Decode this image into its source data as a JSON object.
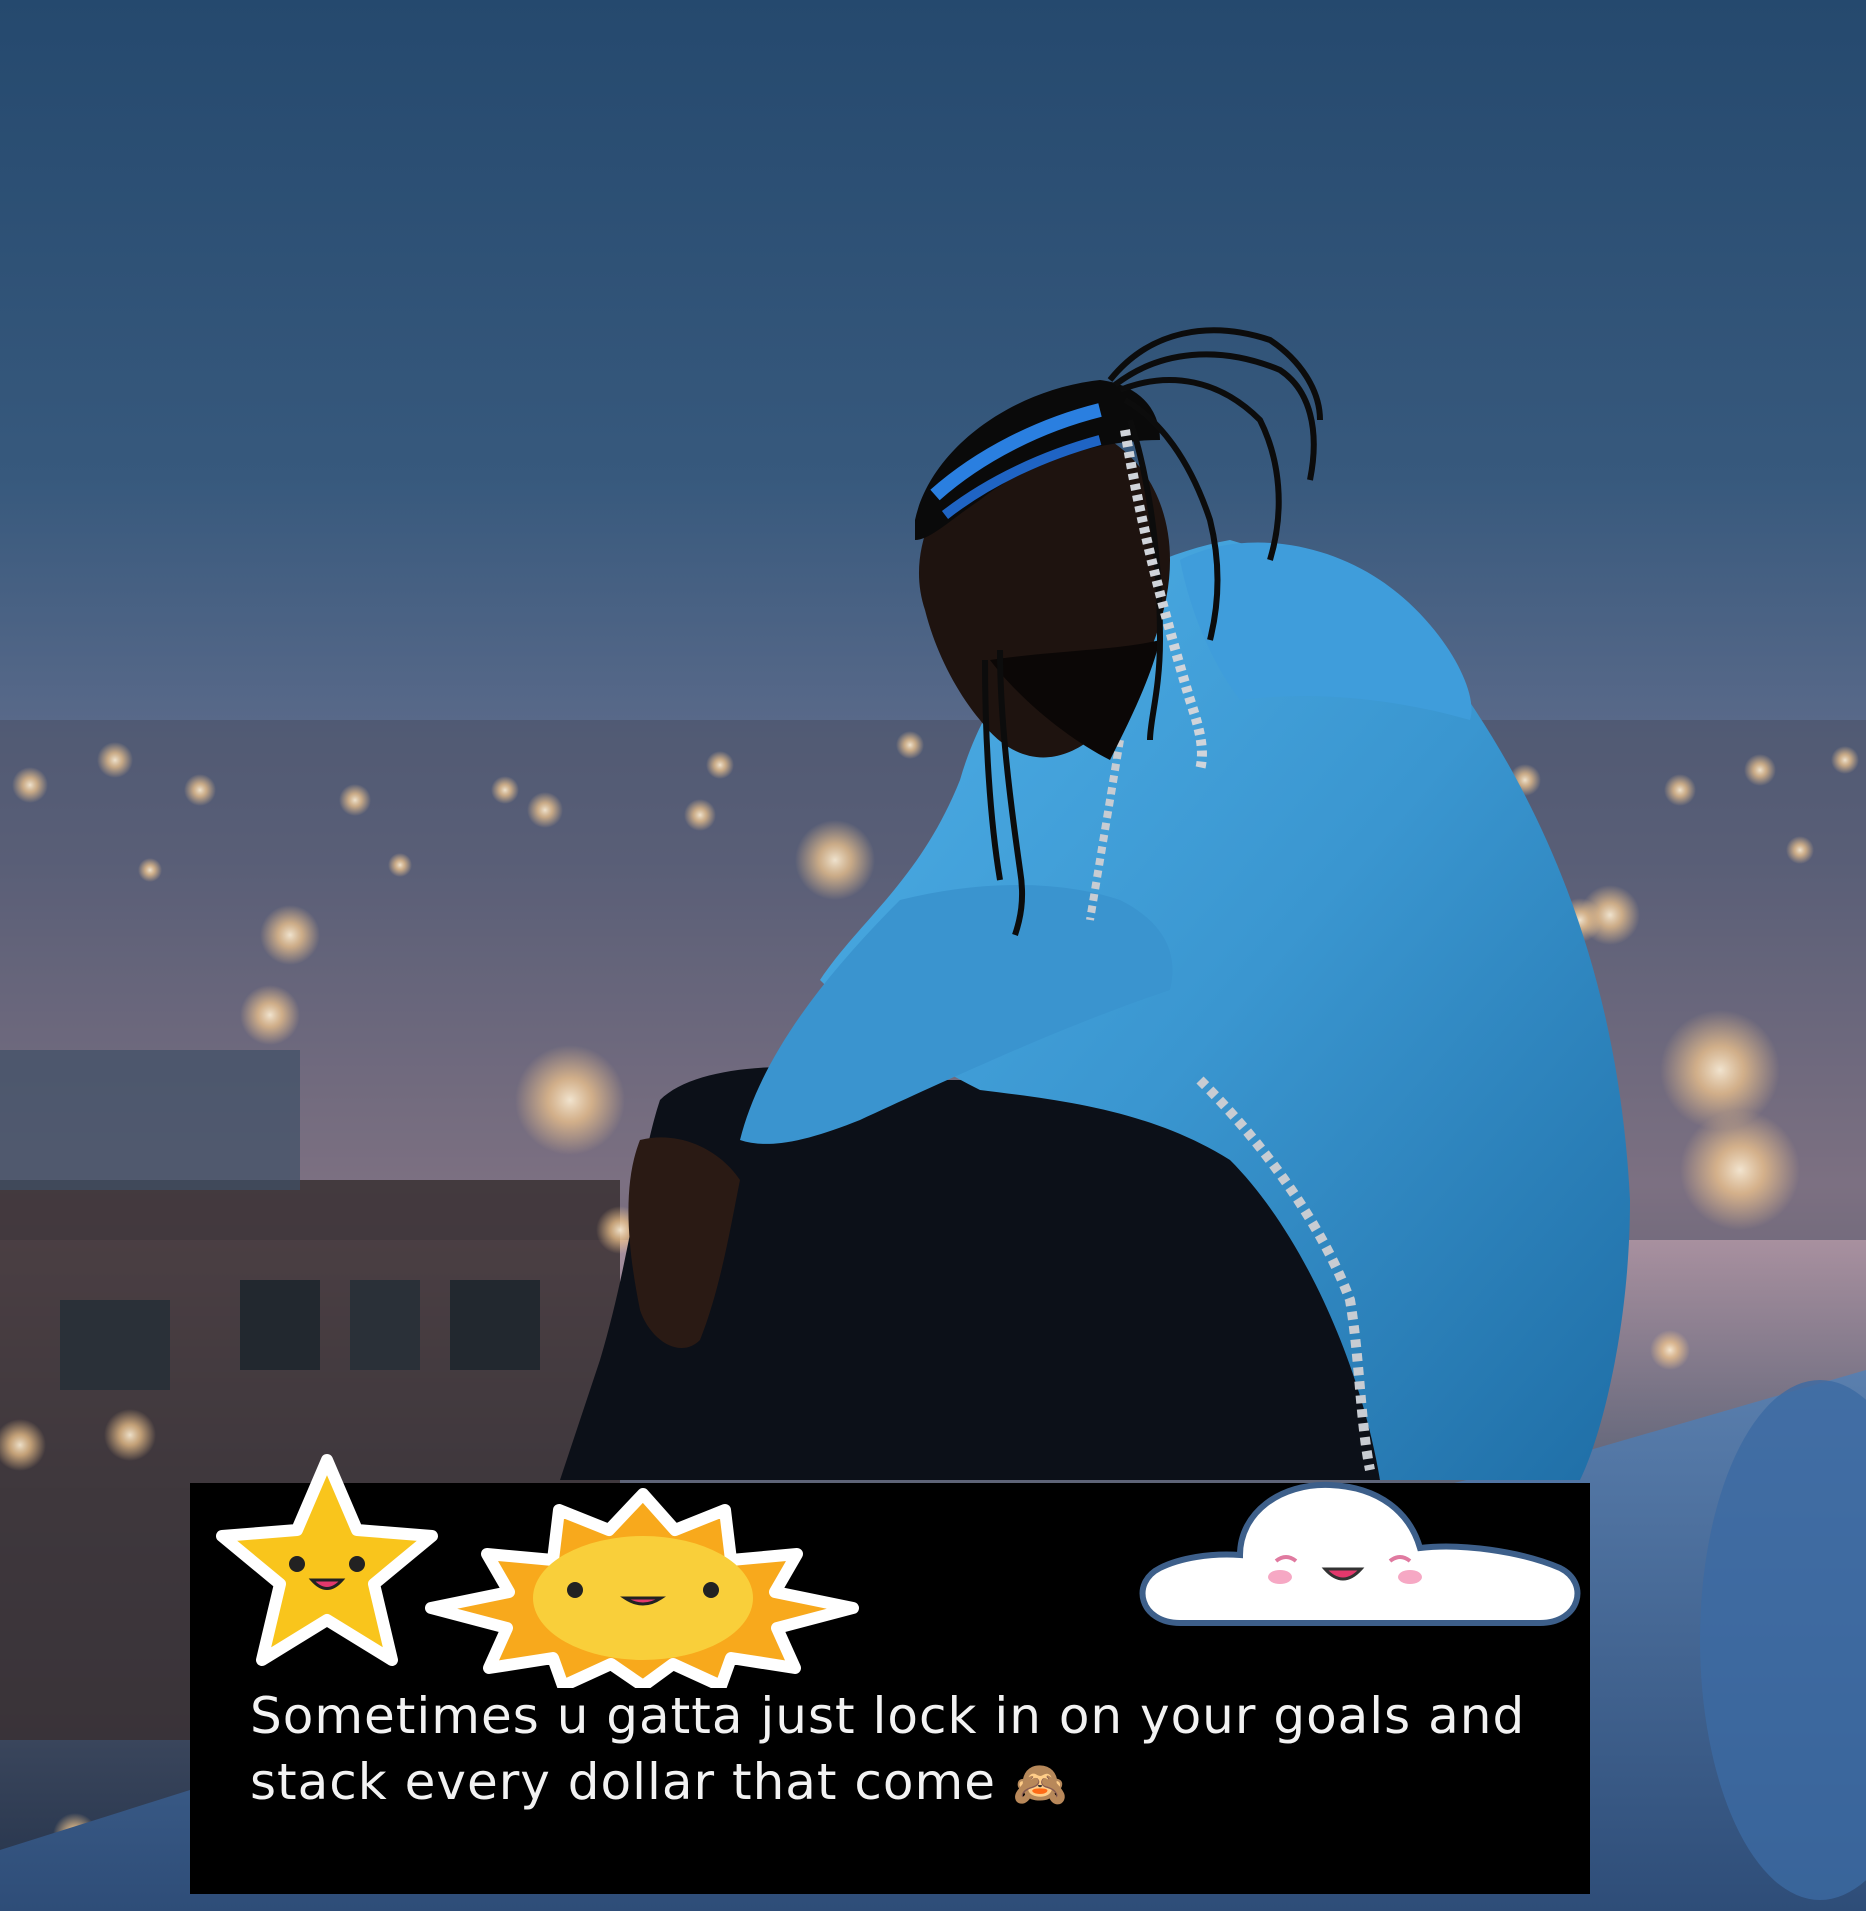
{
  "caption": {
    "text": "Sometimes u gatta just lock in on your goals and stack every dollar that come",
    "emoji": "🙈"
  },
  "stickers": [
    {
      "name": "smiling-star",
      "color": "#f9c51c"
    },
    {
      "name": "smiling-sun",
      "color": "#f8b31a"
    },
    {
      "name": "smiling-cloud",
      "color": "#ffffff"
    }
  ],
  "colors": {
    "sky_top": "#2e5479",
    "sky_bottom": "#c9a8b4",
    "hoodie": "#3c9ad3",
    "caption_bg": "#000000",
    "caption_text": "#f2f2f2"
  }
}
